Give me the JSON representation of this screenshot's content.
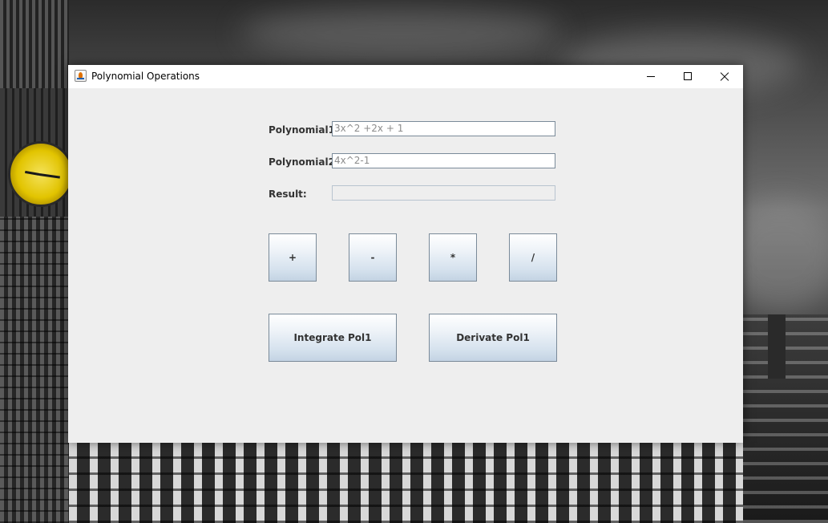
{
  "window": {
    "title": "Polynomial Operations"
  },
  "form": {
    "polynomial1_label": "Polynomial1:",
    "polynomial1_value": "3x^2 +2x + 1",
    "polynomial2_label": "Polynomial2:",
    "polynomial2_value": "4x^2-1",
    "result_label": "Result:",
    "result_value": ""
  },
  "operations": {
    "add_label": "+",
    "subtract_label": "-",
    "multiply_label": "*",
    "divide_label": "/",
    "integrate_label": "Integrate Pol1",
    "derivate_label": "Derivate Pol1"
  },
  "icons": {
    "app": "java-app-icon",
    "minimize": "minimize-icon",
    "maximize": "maximize-icon",
    "close": "close-icon"
  },
  "colors": {
    "window_background": "#eeeeee",
    "button_gradient_top": "#ffffff",
    "button_gradient_bottom": "#c3d3e3",
    "label_text": "#333333",
    "field_text": "#8c8c8c"
  }
}
